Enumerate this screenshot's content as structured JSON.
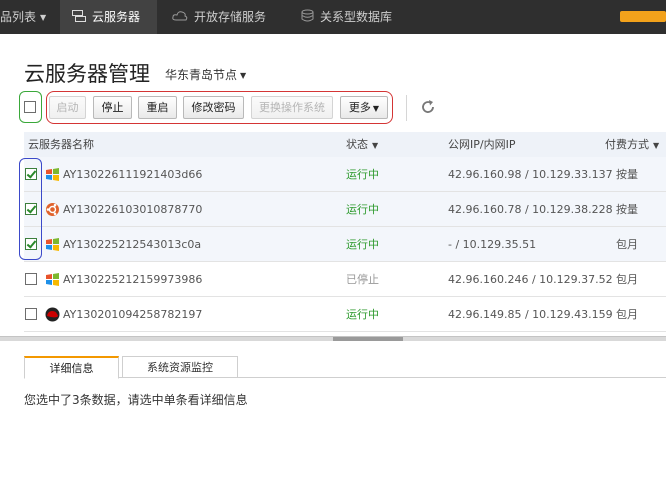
{
  "topnav": {
    "product_list": "品列表",
    "items": [
      {
        "label": "云服务器",
        "icon": "server-icon"
      },
      {
        "label": "开放存储服务",
        "icon": "cloud-storage-icon"
      },
      {
        "label": "关系型数据库",
        "icon": "database-icon"
      }
    ],
    "accent_color": "#f3a21b"
  },
  "header": {
    "title": "云服务器管理",
    "region": "华东青岛节点"
  },
  "toolbar": {
    "start": "启动",
    "stop": "停止",
    "restart": "重启",
    "change_password": "修改密码",
    "change_os": "更换操作系统",
    "more": "更多"
  },
  "table": {
    "columns": {
      "name": "云服务器名称",
      "status": "状态",
      "ip": "公网IP/内网IP",
      "billing": "付费方式"
    },
    "rows": [
      {
        "name": "AY130226111921403d66",
        "os_icon": "windows-icon",
        "status": "运行中",
        "ip": "42.96.160.98 / 10.129.33.137",
        "billing": "按量",
        "checked": true
      },
      {
        "name": "AY130226103010878770",
        "os_icon": "ubuntu-icon",
        "status": "运行中",
        "ip": "42.96.160.78 / 10.129.38.228",
        "billing": "按量",
        "checked": true
      },
      {
        "name": "AY130225212543013c0a",
        "os_icon": "windows-icon",
        "status": "运行中",
        "ip": "- / 10.129.35.51",
        "billing": "包月",
        "checked": true
      },
      {
        "name": "AY130225212159973986",
        "os_icon": "windows-icon",
        "status": "已停止",
        "ip": "42.96.160.246 / 10.129.37.52",
        "billing": "包月",
        "checked": false
      },
      {
        "name": "AY130201094258782197",
        "os_icon": "redhat-icon",
        "status": "运行中",
        "ip": "42.96.149.85 / 10.129.43.159",
        "billing": "包月",
        "checked": false
      }
    ]
  },
  "detail": {
    "tabs": [
      "详细信息",
      "系统资源监控"
    ],
    "message": "您选中了3条数据，请选中单条看详细信息"
  }
}
